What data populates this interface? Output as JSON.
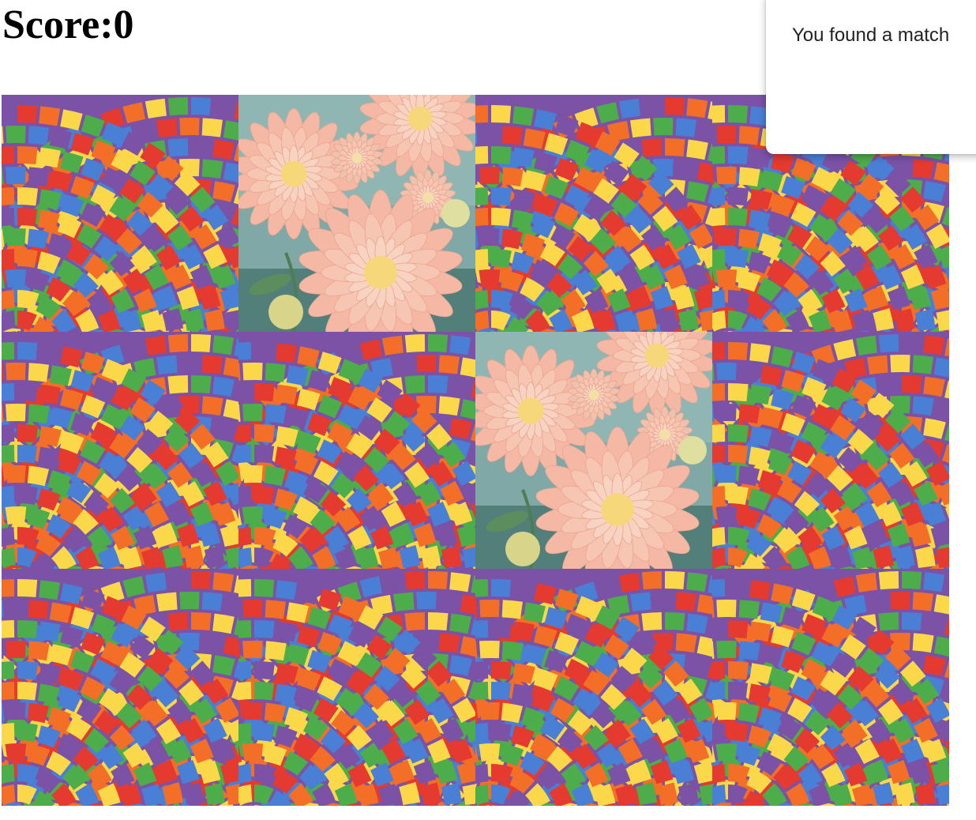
{
  "score": {
    "label": "Score:",
    "value": "0"
  },
  "notification": {
    "message": "You found a match"
  },
  "board": {
    "columns": 4,
    "rows": 3,
    "cards": [
      {
        "state": "face-down",
        "image": "rainbow-arcs-card-back"
      },
      {
        "state": "face-up",
        "image": "pink-dahlia-flowers"
      },
      {
        "state": "face-down",
        "image": "rainbow-arcs-card-back"
      },
      {
        "state": "face-down",
        "image": "rainbow-arcs-card-back"
      },
      {
        "state": "face-down",
        "image": "rainbow-arcs-card-back"
      },
      {
        "state": "face-down",
        "image": "rainbow-arcs-card-back"
      },
      {
        "state": "face-up",
        "image": "pink-dahlia-flowers"
      },
      {
        "state": "face-down",
        "image": "rainbow-arcs-card-back"
      },
      {
        "state": "face-down",
        "image": "rainbow-arcs-card-back"
      },
      {
        "state": "face-down",
        "image": "rainbow-arcs-card-back"
      },
      {
        "state": "face-down",
        "image": "rainbow-arcs-card-back"
      },
      {
        "state": "face-down",
        "image": "rainbow-arcs-card-back"
      }
    ]
  },
  "colors": {
    "card_back_palette": [
      "#e53a2f",
      "#f36f27",
      "#fbd84a",
      "#4cad4a",
      "#4a7fd6",
      "#7b52a6"
    ],
    "flower_petal": "#f4b8a4",
    "flower_center": "#f6d87a",
    "flower_background": "#7fa8a6"
  }
}
